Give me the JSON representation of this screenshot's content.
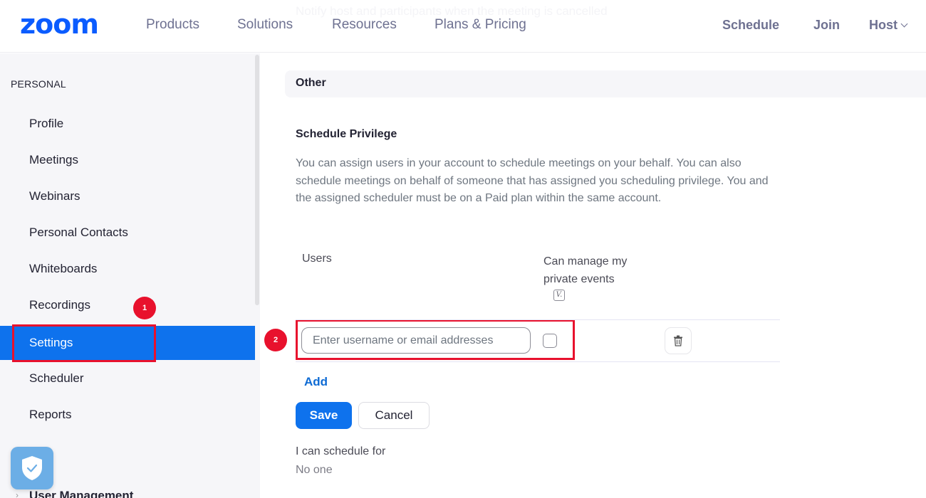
{
  "header": {
    "logo": "zoom",
    "nav": [
      "Products",
      "Solutions",
      "Resources",
      "Plans & Pricing"
    ],
    "ghost_text": "Notify host and participants when the meeting is cancelled",
    "right": {
      "schedule": "Schedule",
      "join": "Join",
      "host": "Host"
    }
  },
  "sidebar": {
    "section": "PERSONAL",
    "items": [
      {
        "label": "Profile",
        "active": false
      },
      {
        "label": "Meetings",
        "active": false
      },
      {
        "label": "Webinars",
        "active": false
      },
      {
        "label": "Personal Contacts",
        "active": false
      },
      {
        "label": "Whiteboards",
        "active": false
      },
      {
        "label": "Recordings",
        "active": false
      },
      {
        "label": "Settings",
        "active": true
      },
      {
        "label": "Scheduler",
        "active": false
      },
      {
        "label": "Reports",
        "active": false
      }
    ],
    "partial_item": "User Management",
    "shield_icon": "shield-check-icon"
  },
  "annotations": {
    "badge1": "1",
    "badge2": "2",
    "color": "#e8112d"
  },
  "main": {
    "section_title": "Other",
    "privilege": {
      "title": "Schedule Privilege",
      "description": "You can assign users in your account to schedule meetings on your behalf. You can also schedule meetings on behalf of someone that has assigned you scheduling privilege. You and the assigned scheduler must be on a Paid plan within the same account.",
      "columns": {
        "users": "Users",
        "manage": "Can manage my private events"
      },
      "v_icon": "V.",
      "row": {
        "input_value": "",
        "input_placeholder": "Enter username or email addresses",
        "checked": false
      },
      "add_label": "Add",
      "save_label": "Save",
      "cancel_label": "Cancel",
      "i_can_label": "I can schedule for",
      "i_can_value": "No one"
    }
  },
  "colors": {
    "brand": "#0b5cff",
    "active": "#0e72ed",
    "link": "#0e6bd4",
    "nav_text": "#6e7191"
  }
}
